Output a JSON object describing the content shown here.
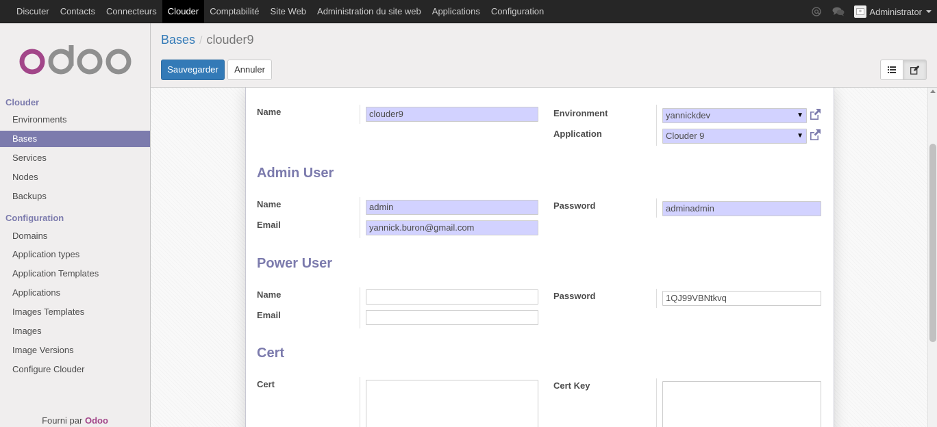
{
  "topbar": {
    "menu": [
      "Discuter",
      "Contacts",
      "Connecteurs",
      "Clouder",
      "Comptabilité",
      "Site Web",
      "Administration du site web",
      "Applications",
      "Configuration"
    ],
    "active_index": 3,
    "user": "Administrator",
    "icons": [
      "at-icon",
      "chat-icon",
      "avatar-icon"
    ]
  },
  "sidebar": {
    "sections": [
      {
        "title": "Clouder",
        "items": [
          "Environments",
          "Bases",
          "Services",
          "Nodes",
          "Backups"
        ]
      },
      {
        "title": "Configuration",
        "items": [
          "Domains",
          "Application types",
          "Application Templates",
          "Applications",
          "Images Templates",
          "Images",
          "Image Versions",
          "Configure Clouder"
        ]
      }
    ],
    "active_item": "Bases",
    "footer_prefix": "Fourni par",
    "footer_brand": "Odoo"
  },
  "breadcrumb": {
    "parent": "Bases",
    "separator": "/",
    "current": "clouder9"
  },
  "buttons": {
    "save": "Sauvegarder",
    "cancel": "Annuler"
  },
  "form": {
    "main": {
      "name_label": "Name",
      "name_value": "clouder9",
      "environment_label": "Environment",
      "environment_value": "yannickdev",
      "application_label": "Application",
      "application_value": "Clouder 9"
    },
    "admin": {
      "heading": "Admin User",
      "name_label": "Name",
      "name_value": "admin",
      "email_label": "Email",
      "email_value": "yannick.buron@gmail.com",
      "password_label": "Password",
      "password_value": "adminadmin"
    },
    "power": {
      "heading": "Power User",
      "name_label": "Name",
      "name_value": "",
      "email_label": "Email",
      "email_value": "",
      "password_label": "Password",
      "password_value": "1QJ99VBNtkvq"
    },
    "cert": {
      "heading": "Cert",
      "cert_label": "Cert",
      "cert_value": "",
      "cert_key_label": "Cert Key",
      "cert_key_value": ""
    }
  },
  "colors": {
    "accent": "#7c7bad",
    "primary": "#337ab7",
    "required_field": "#d2d2ff",
    "navbar": "#262626",
    "brand": "#a24689"
  }
}
